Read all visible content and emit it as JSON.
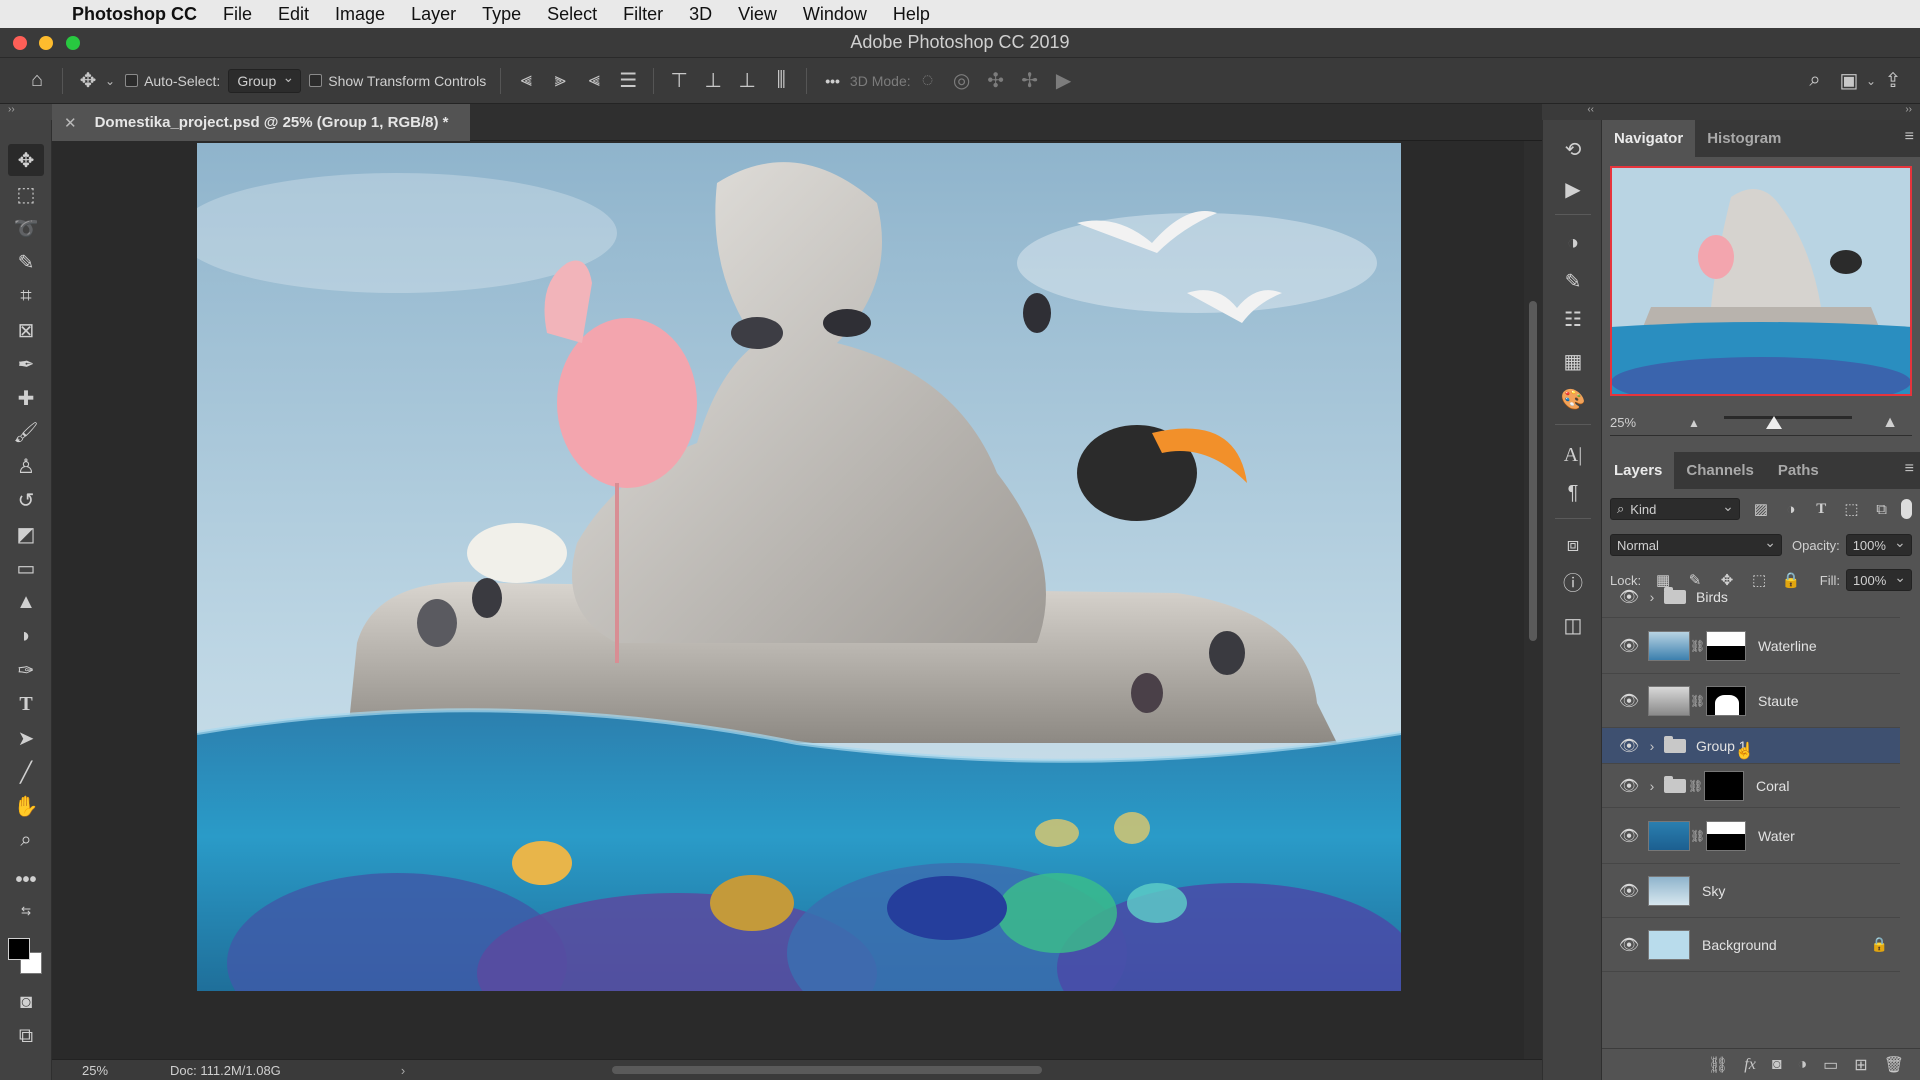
{
  "menubar": {
    "app": "Photoshop CC",
    "items": [
      "File",
      "Edit",
      "Image",
      "Layer",
      "Type",
      "Select",
      "Filter",
      "3D",
      "View",
      "Window",
      "Help"
    ]
  },
  "window": {
    "title": "Adobe Photoshop CC 2019"
  },
  "options": {
    "auto_select_label": "Auto-Select:",
    "auto_select_value": "Group",
    "transform_label": "Show Transform Controls",
    "more_label": "•••",
    "mode_3d_label": "3D Mode:"
  },
  "document": {
    "tab_title": "Domestika_project.psd @ 25% (Group 1, RGB/8) *",
    "zoom": "25%",
    "doc_info": "Doc: 111.2M/1.08G",
    "status_arrow": "›"
  },
  "navigator": {
    "tabs": [
      "Navigator",
      "Histogram"
    ],
    "zoom": "25%"
  },
  "layers_panel": {
    "tabs": [
      "Layers",
      "Channels",
      "Paths"
    ],
    "filter_kind": "Kind",
    "blend_mode": "Normal",
    "opacity_label": "Opacity:",
    "opacity_value": "100%",
    "lock_label": "Lock:",
    "fill_label": "Fill:",
    "fill_value": "100%",
    "layers": [
      {
        "name": "Birds",
        "type": "group"
      },
      {
        "name": "Waterline",
        "type": "masked"
      },
      {
        "name": "Staute",
        "type": "masked"
      },
      {
        "name": "Group 1",
        "type": "group",
        "selected": true
      },
      {
        "name": "Coral",
        "type": "group-masked"
      },
      {
        "name": "Water",
        "type": "masked"
      },
      {
        "name": "Sky",
        "type": "layer"
      },
      {
        "name": "Background",
        "type": "background",
        "locked": true
      }
    ]
  },
  "icons": {
    "eye": "👁",
    "chevron": "›",
    "link": "⛓",
    "lock": "🔒"
  }
}
